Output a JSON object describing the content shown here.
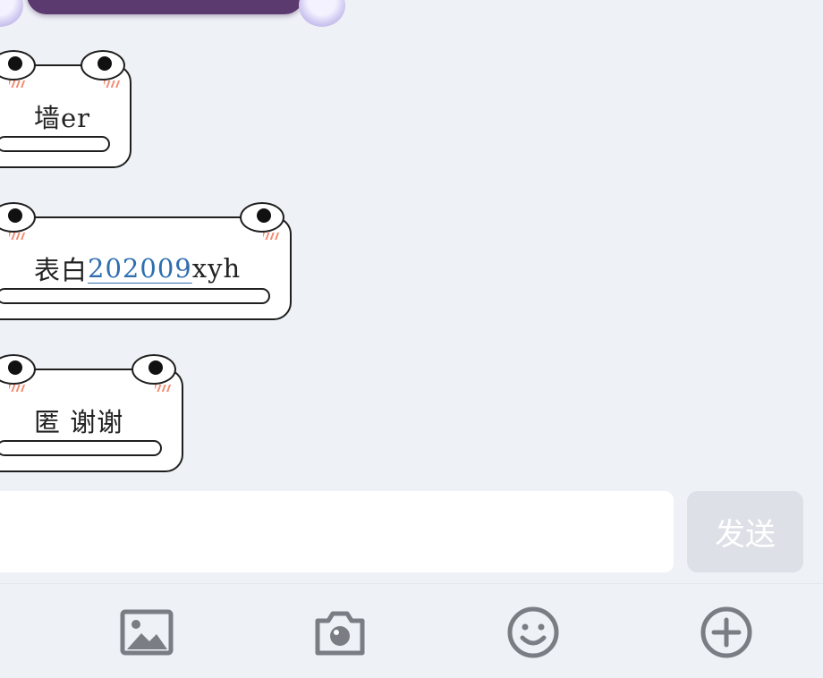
{
  "messages": [
    {
      "text": "墙er"
    },
    {
      "text_prefix": "表白",
      "link": "202009",
      "text_suffix": "xyh"
    },
    {
      "text": "匿 谢谢"
    }
  ],
  "composer": {
    "send_label": "发送"
  },
  "toolbar": {
    "icons": [
      "image-icon",
      "camera-icon",
      "emoji-icon",
      "plus-icon"
    ]
  },
  "colors": {
    "background": "#eef1f6",
    "link": "#2f6fb0",
    "send_disabled": "#dde0e6",
    "icon": "#7a7d84"
  }
}
